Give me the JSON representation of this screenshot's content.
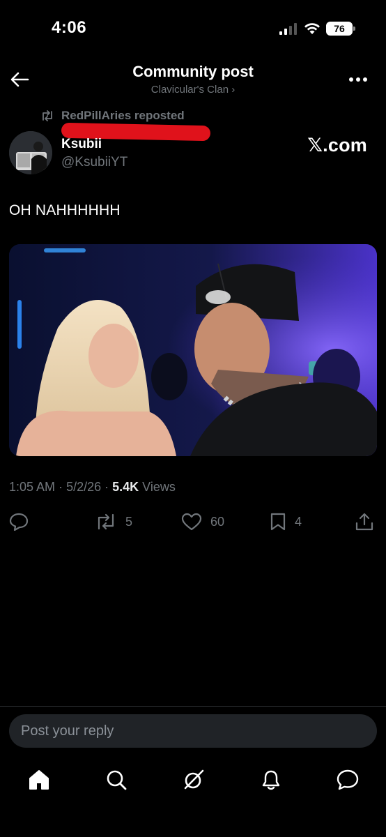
{
  "status_bar": {
    "time": "4:06",
    "battery": "76",
    "icons": [
      "signal-icon",
      "wifi-icon",
      "battery-icon"
    ]
  },
  "header": {
    "title": "Community post",
    "subtitle": "Clavicular's Clan ›",
    "back_icon": "arrow-left-icon",
    "more_icon": "more-icon"
  },
  "repost": {
    "text": "RedPillAries reposted",
    "icon": "repost-icon"
  },
  "author": {
    "name": "Ksubii",
    "handle": "@KsubiiYT",
    "source_badge": "𝕏.com"
  },
  "post": {
    "text": "OH NAHHHHHH",
    "media_subject": "photo-two-people-at-party",
    "meta": {
      "time": "1:05 AM",
      "date": "5/2/26",
      "views_count": "5.4K",
      "views_label": "Views"
    }
  },
  "actions": {
    "reply": {
      "icon": "reply-icon",
      "count": ""
    },
    "repost": {
      "icon": "repost-icon",
      "count": "5"
    },
    "like": {
      "icon": "heart-icon",
      "count": "60"
    },
    "bookmark": {
      "icon": "bookmark-icon",
      "count": "4"
    },
    "share": {
      "icon": "share-icon",
      "count": ""
    }
  },
  "reply_input": {
    "placeholder": "Post your reply"
  },
  "bottom_nav": [
    "home-icon",
    "search-icon",
    "grok-icon",
    "notifications-icon",
    "messages-icon"
  ],
  "colors": {
    "background": "#000000",
    "text": "#e7e9ea",
    "muted": "#71767b",
    "reply_box": "#202327",
    "redaction": "#e0121b"
  }
}
